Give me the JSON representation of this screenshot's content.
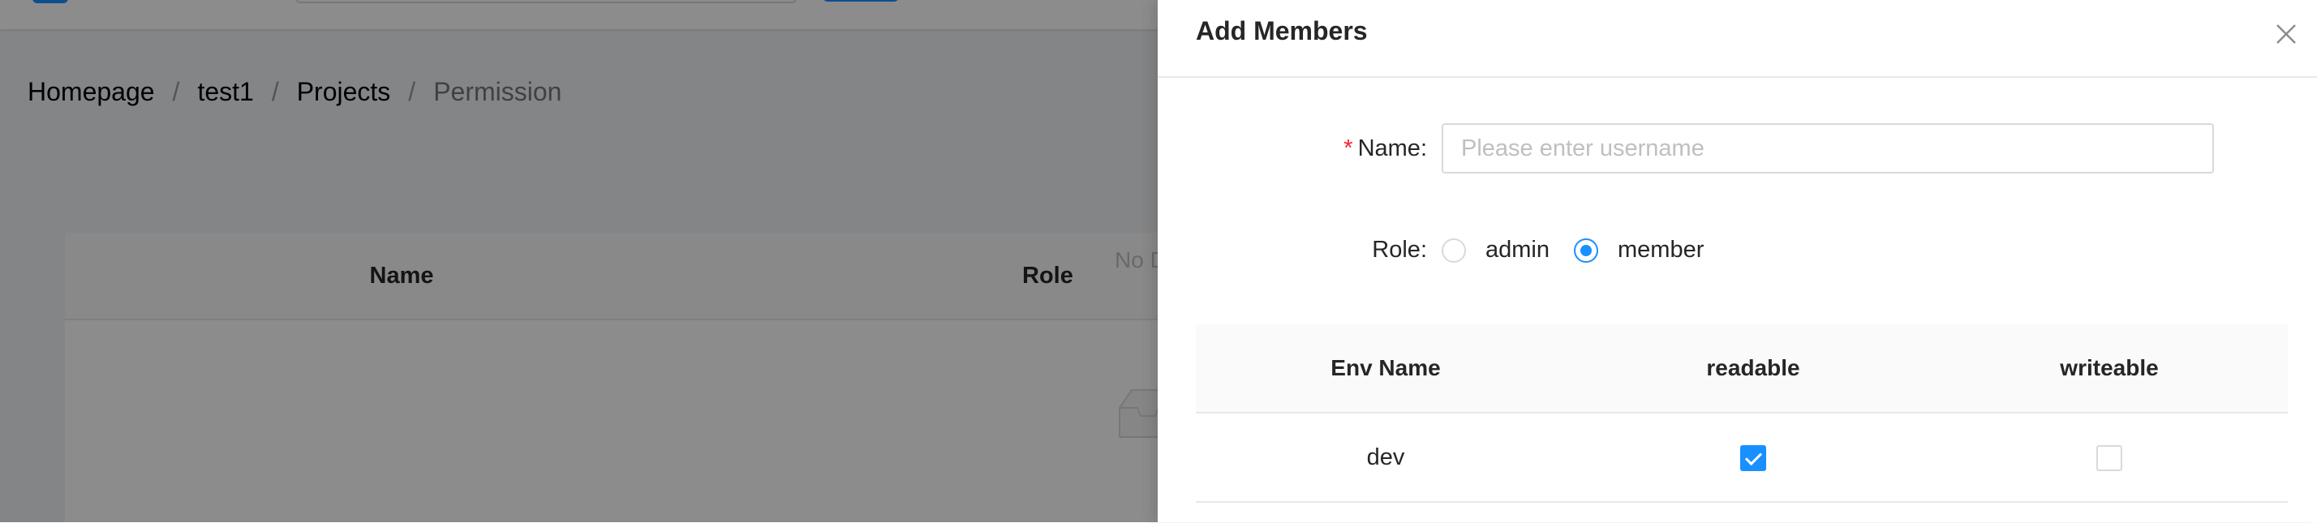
{
  "breadcrumb": {
    "items": [
      "Homepage",
      "test1",
      "Projects",
      "Permission"
    ],
    "separator": "/"
  },
  "background_table": {
    "columns": [
      "Name",
      "Role"
    ],
    "empty_text": "No D"
  },
  "drawer": {
    "title": "Add Members",
    "close_icon": "close-icon",
    "name_field": {
      "label": "Name",
      "colon": ":",
      "required_mark": "*",
      "value": "",
      "placeholder": "Please enter username"
    },
    "role_field": {
      "label": "Role",
      "colon": ":",
      "options": [
        "admin",
        "member"
      ],
      "selected": "member"
    },
    "env_table": {
      "columns": [
        "Env Name",
        "readable",
        "writeable"
      ],
      "rows": [
        {
          "env_name": "dev",
          "readable": true,
          "writeable": false
        }
      ]
    }
  },
  "colors": {
    "accent": "#1890ff",
    "required": "#f5222d",
    "mask": "rgba(0,0,0,0.45)"
  }
}
